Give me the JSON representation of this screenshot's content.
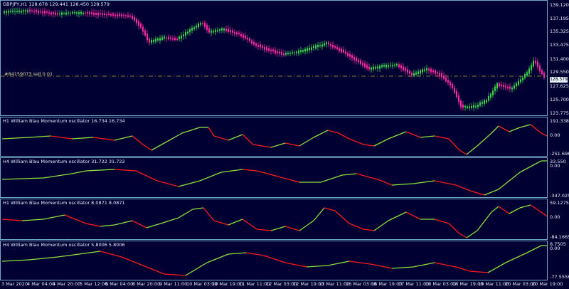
{
  "symbol_header": "GBPJPY,H1  128.678 129.441 128.450 128.579",
  "trade_label": "#84159073 sell 0.01",
  "current_price": "128.579",
  "price_axis": [
    "139.120",
    "137.195",
    "135.325",
    "133.475",
    "131.400",
    "129.550",
    "127.625",
    "125.700",
    "123.775"
  ],
  "panels": [
    {
      "title": "H1 William Blau Momentum oscillator 16.734 16.734",
      "axis": [
        "191.338",
        "0.00",
        "-251.696"
      ]
    },
    {
      "title": "H4 William Blau Momentum oscillator 31.722 31.722",
      "axis": [
        "33.550",
        "0.00",
        "-347.025"
      ]
    },
    {
      "title": "H1 William Blau Momentum oscillator 8.0871 8.0871",
      "axis": [
        "59.1275",
        "0.00",
        "-84.1665"
      ]
    },
    {
      "title": "H4 William Blau Momentum oscillator 5.8006 5.8006",
      "axis": [
        "8.7505",
        "0.00",
        "-77.5556"
      ]
    }
  ],
  "time_axis": [
    "3 Mar 2020",
    "4 Mar 04:00",
    "4 Mar 20:00",
    "5 Mar 12:00",
    "6 Mar 04:00",
    "6 Mar 20:00",
    "9 Mar 11:00",
    "10 Mar 03:00",
    "10 Mar 19:00",
    "11 Mar 11:00",
    "12 Mar 03:00",
    "12 Mar 19:00",
    "13 Mar 11:00",
    "16 Mar 03:00",
    "16 Mar 19:00",
    "17 Mar 11:00",
    "18 Mar 03:00",
    "18 Mar 19:00",
    "19 Mar 11:00",
    "20 Mar 03:00",
    "20 Mar 19:00"
  ],
  "colors": {
    "bull": "#3cd24a",
    "bear": "#ff2aa0",
    "osc_up": "#8ce23a",
    "osc_down": "#ff1a1a",
    "grid_line": "#b8a832",
    "border": "#6fa8c8"
  }
}
